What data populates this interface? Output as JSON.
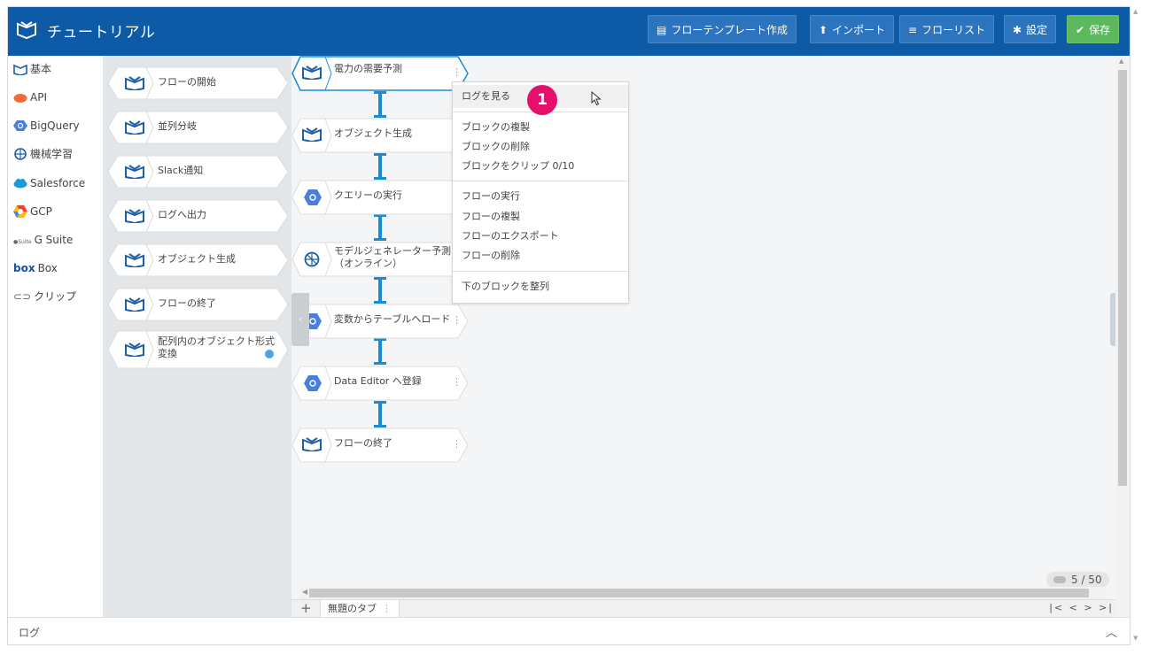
{
  "app": {
    "title": "チュートリアル"
  },
  "header_buttons": [
    {
      "label": "フローテンプレート作成",
      "icon": "template-icon"
    },
    {
      "label": "インポート",
      "icon": "upload-icon"
    },
    {
      "label": "フローリスト",
      "icon": "list-icon"
    },
    {
      "label": "設定",
      "icon": "gear-icon"
    },
    {
      "label": "保存",
      "icon": "check-circle-icon"
    }
  ],
  "sidebar": {
    "items": [
      {
        "label": "基本",
        "icon": "magellan-logo-icon"
      },
      {
        "label": "API",
        "icon": "api-icon"
      },
      {
        "label": "BigQuery",
        "icon": "bigquery-icon"
      },
      {
        "label": "機械学習",
        "icon": "brain-icon"
      },
      {
        "label": "Salesforce",
        "icon": "cloud-icon"
      },
      {
        "label": "GCP",
        "icon": "gcp-icon"
      },
      {
        "label": "G Suite",
        "icon": "gsuite-icon",
        "prefix": "G Suite"
      },
      {
        "label": "Box",
        "icon": "box-icon",
        "prefix": "box"
      },
      {
        "label": "クリップ",
        "icon": "paperclip-icon"
      }
    ]
  },
  "palette": {
    "blocks": [
      {
        "label": "フローの開始"
      },
      {
        "label": "並列分岐"
      },
      {
        "label": "Slack通知"
      },
      {
        "label": "ログへ出力"
      },
      {
        "label": "オブジェクト生成"
      },
      {
        "label": "フローの終了"
      },
      {
        "label_line1": "配列内のオブジェクト形式",
        "label_line2": "変換"
      }
    ]
  },
  "flow": {
    "blocks": [
      {
        "label": "電力の需要予測",
        "icon": "magellan-logo-icon"
      },
      {
        "label": "オブジェクト生成",
        "icon": "magellan-logo-icon"
      },
      {
        "label": "クエリーの実行",
        "icon": "bigquery-icon"
      },
      {
        "label_line1": "モデルジェネレーター予測",
        "label_line2": "（オンライン）",
        "icon": "brain-icon"
      },
      {
        "label": "変数からテーブルへロード",
        "icon": "bigquery-icon"
      },
      {
        "label": "Data Editor へ登録",
        "icon": "bigquery-icon"
      },
      {
        "label": "フローの終了",
        "icon": "magellan-logo-icon"
      }
    ]
  },
  "context_menu": {
    "groups": [
      [
        "ログを見る"
      ],
      [
        "ブロックの複製",
        "ブロックの削除",
        "ブロックをクリップ 0/10"
      ],
      [
        "フローの実行",
        "フローの複製",
        "フローのエクスポート",
        "フローの削除"
      ],
      [
        "下のブロックを整列"
      ]
    ]
  },
  "step_badge": "1",
  "tabs": {
    "add_label": "+",
    "items": [
      "無題のタブ"
    ]
  },
  "counter": "5 / 50",
  "pager": "|<  <  >  >|",
  "log_panel": {
    "label": "ログ"
  },
  "colors": {
    "header": "#0d5aa7",
    "save": "#5cb85c",
    "badge": "#e4106c",
    "connector": "#1a8bd4"
  }
}
